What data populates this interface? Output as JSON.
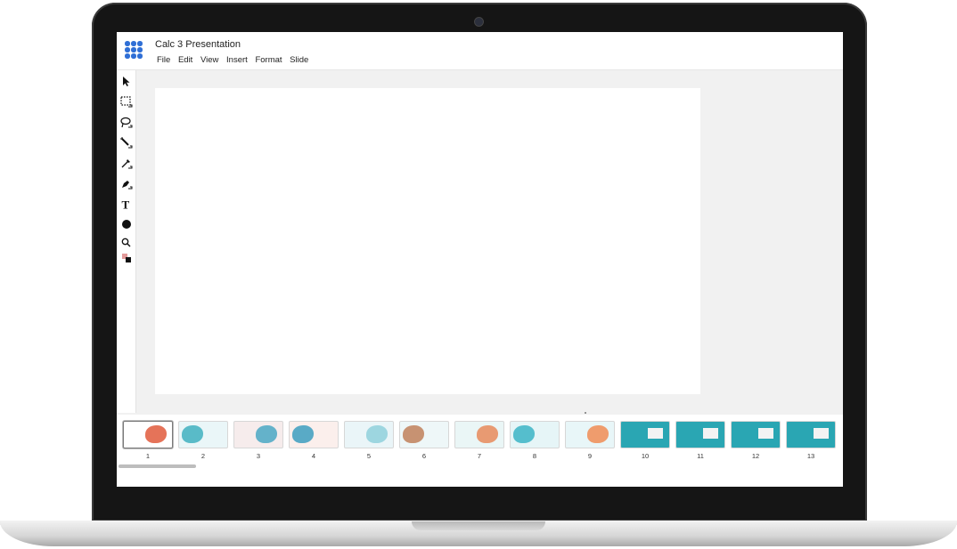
{
  "app": {
    "title": "Calc 3 Presentation"
  },
  "menu": [
    "File",
    "Edit",
    "View",
    "Insert",
    "Format",
    "Slide"
  ],
  "tools": [
    {
      "name": "pointer-tool",
      "icon": "cursor-arrow-icon"
    },
    {
      "name": "select-rect-tool",
      "icon": "marquee-icon"
    },
    {
      "name": "lasso-tool",
      "icon": "lasso-icon"
    },
    {
      "name": "magic-wand-tool",
      "icon": "magic-wand-icon"
    },
    {
      "name": "eyedropper-tool",
      "icon": "eyedropper-icon"
    },
    {
      "name": "pen-tool",
      "icon": "pen-icon"
    },
    {
      "name": "text-tool",
      "icon": "text-icon"
    },
    {
      "name": "shape-tool",
      "icon": "circle-icon"
    },
    {
      "name": "zoom-tool",
      "icon": "magnifier-icon"
    },
    {
      "name": "color-swap-tool",
      "icon": "color-swatch-icon"
    }
  ],
  "slides": [
    {
      "num": "1",
      "bg": "#ffffff",
      "accent": "#e05a3c",
      "selected": true
    },
    {
      "num": "2",
      "bg": "#eaf6f8",
      "accent": "#3fb0c0",
      "selected": false
    },
    {
      "num": "3",
      "bg": "#f6ecec",
      "accent": "#4aa8c4",
      "selected": false
    },
    {
      "num": "4",
      "bg": "#fbefec",
      "accent": "#3c9dbf",
      "selected": false
    },
    {
      "num": "5",
      "bg": "#eaf5f8",
      "accent": "#8fd0dc",
      "selected": false
    },
    {
      "num": "6",
      "bg": "#eef7f8",
      "accent": "#c0805a",
      "selected": false
    },
    {
      "num": "7",
      "bg": "#eaf6f6",
      "accent": "#e88a5a",
      "selected": false
    },
    {
      "num": "8",
      "bg": "#e6f5f7",
      "accent": "#3bb4c6",
      "selected": false
    },
    {
      "num": "9",
      "bg": "#e8f6f8",
      "accent": "#f08c55",
      "selected": false
    },
    {
      "num": "10",
      "bg": "#2aa6b3",
      "accent": "#ffffff",
      "selected": false
    },
    {
      "num": "11",
      "bg": "#2aa6b3",
      "accent": "#ffffff",
      "selected": false
    },
    {
      "num": "12",
      "bg": "#2aa6b3",
      "accent": "#ffffff",
      "selected": false
    },
    {
      "num": "13",
      "bg": "#2aa6b3",
      "accent": "#ffffff",
      "selected": false
    }
  ],
  "colors": {
    "brand": "#2f6fd6"
  }
}
